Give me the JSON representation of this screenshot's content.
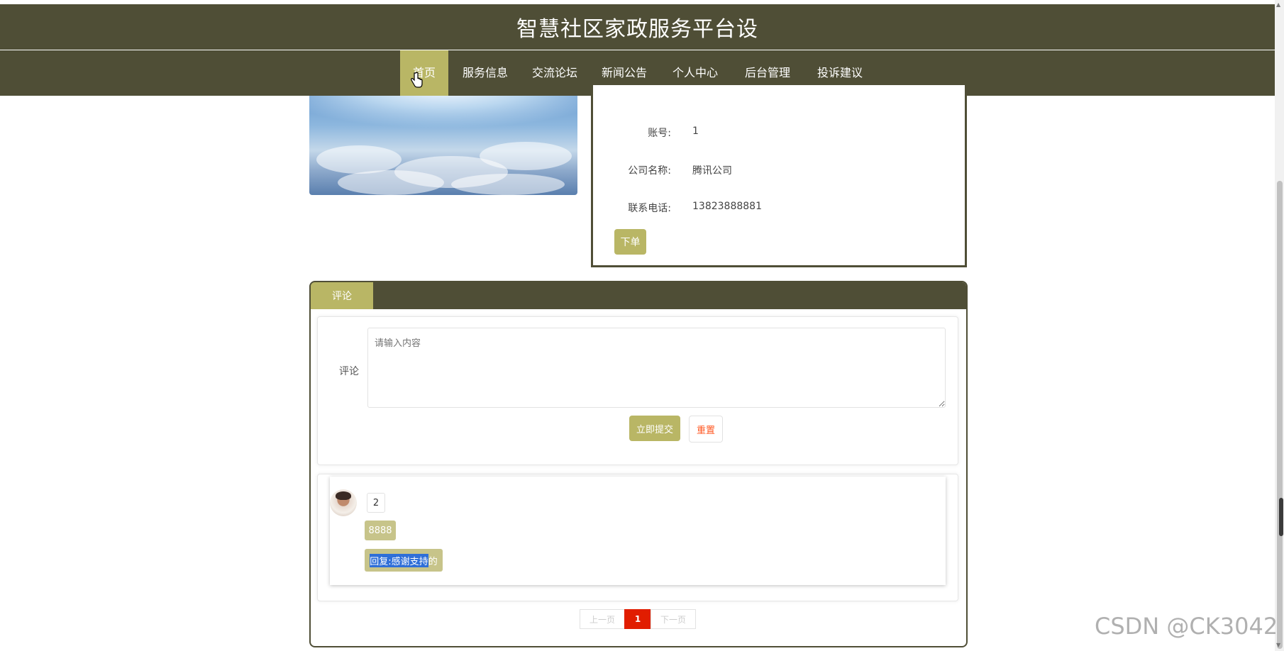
{
  "site": {
    "title": "智慧社区家政服务平台设"
  },
  "nav": {
    "items": [
      {
        "label": "首页",
        "active": true
      },
      {
        "label": "服务信息"
      },
      {
        "label": "交流论坛"
      },
      {
        "label": "新闻公告"
      },
      {
        "label": "个人中心"
      },
      {
        "label": "后台管理"
      },
      {
        "label": "投诉建议"
      }
    ]
  },
  "service": {
    "fields": [
      {
        "label": "账号:",
        "value": "1"
      },
      {
        "label": "公司名称:",
        "value": "腾讯公司"
      },
      {
        "label": "联系电话:",
        "value": "13823888881"
      }
    ],
    "order_label": "下单"
  },
  "comment_panel": {
    "tab_label": "评论",
    "form": {
      "label": "评论",
      "placeholder": "请输入内容",
      "submit_label": "立即提交",
      "reset_label": "重置"
    },
    "comments": [
      {
        "user": "2",
        "content": "8888",
        "reply_selected": "回复:感谢支持",
        "reply_rest": "的"
      }
    ],
    "pager": {
      "prev": "上一页",
      "current": "1",
      "next": "下一页"
    }
  },
  "theme": {
    "primary": "#4f4e36",
    "accent": "#b9b665",
    "danger": "#ff5722",
    "page_active": "#e11d00"
  },
  "watermark": "CSDN @CK3042"
}
